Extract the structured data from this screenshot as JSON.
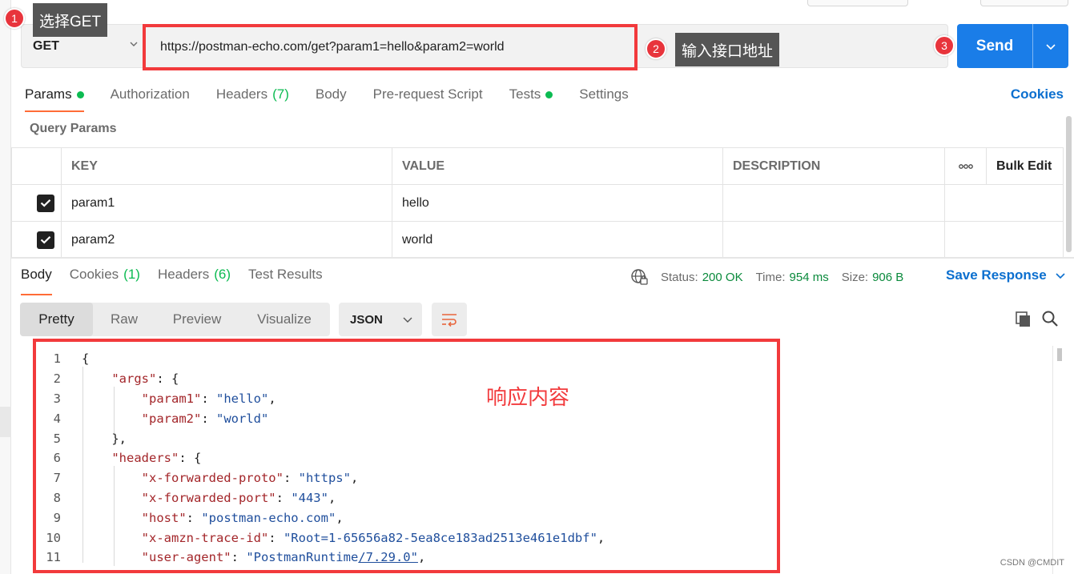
{
  "annotations": [
    {
      "num": "1",
      "text": "选择GET"
    },
    {
      "num": "2",
      "text": "输入接口地址"
    },
    {
      "num": "3",
      "text": ""
    }
  ],
  "request": {
    "method": "GET",
    "url": "https://postman-echo.com/get?param1=hello&param2=world",
    "send_label": "Send"
  },
  "req_tabs": {
    "params": "Params",
    "authorization": "Authorization",
    "headers": "Headers",
    "headers_count": "(7)",
    "body": "Body",
    "pre_request": "Pre-request Script",
    "tests": "Tests",
    "settings": "Settings",
    "cookies": "Cookies"
  },
  "query_params": {
    "title": "Query Params",
    "columns": {
      "key": "KEY",
      "value": "VALUE",
      "description": "DESCRIPTION",
      "bulk_edit": "Bulk Edit"
    },
    "rows": [
      {
        "key": "param1",
        "value": "hello",
        "checked": true
      },
      {
        "key": "param2",
        "value": "world",
        "checked": true
      }
    ]
  },
  "response": {
    "tabs": {
      "body": "Body",
      "cookies": "Cookies",
      "cookies_count": "(1)",
      "headers": "Headers",
      "headers_count": "(6)",
      "test_results": "Test Results"
    },
    "status_label": "Status:",
    "status_value": "200 OK",
    "time_label": "Time:",
    "time_value": "954 ms",
    "size_label": "Size:",
    "size_value": "906 B",
    "save_label": "Save Response",
    "views": {
      "pretty": "Pretty",
      "raw": "Raw",
      "preview": "Preview",
      "visualize": "Visualize"
    },
    "format": "JSON",
    "note": "响应内容",
    "code": {
      "l1": "{",
      "l2_key": "\"args\"",
      "l2_rest": ": {",
      "l3_key": "\"param1\"",
      "l3_val": "\"hello\"",
      "l4_key": "\"param2\"",
      "l4_val": "\"world\"",
      "l5": "},",
      "l6_key": "\"headers\"",
      "l6_rest": ": {",
      "l7_key": "\"x-forwarded-proto\"",
      "l7_val": "\"https\"",
      "l8_key": "\"x-forwarded-port\"",
      "l8_val": "\"443\"",
      "l9_key": "\"host\"",
      "l9_val": "\"postman-echo.com\"",
      "l10_key": "\"x-amzn-trace-id\"",
      "l10_val": "\"Root=1-65656a82-5ea8ce183ad2513e461e1dbf\"",
      "l11_key": "\"user-agent\"",
      "l11_val_a": "\"PostmanRuntime",
      "l11_val_b": "/7.29.0\""
    }
  },
  "watermark": "CSDN @CMDIT"
}
